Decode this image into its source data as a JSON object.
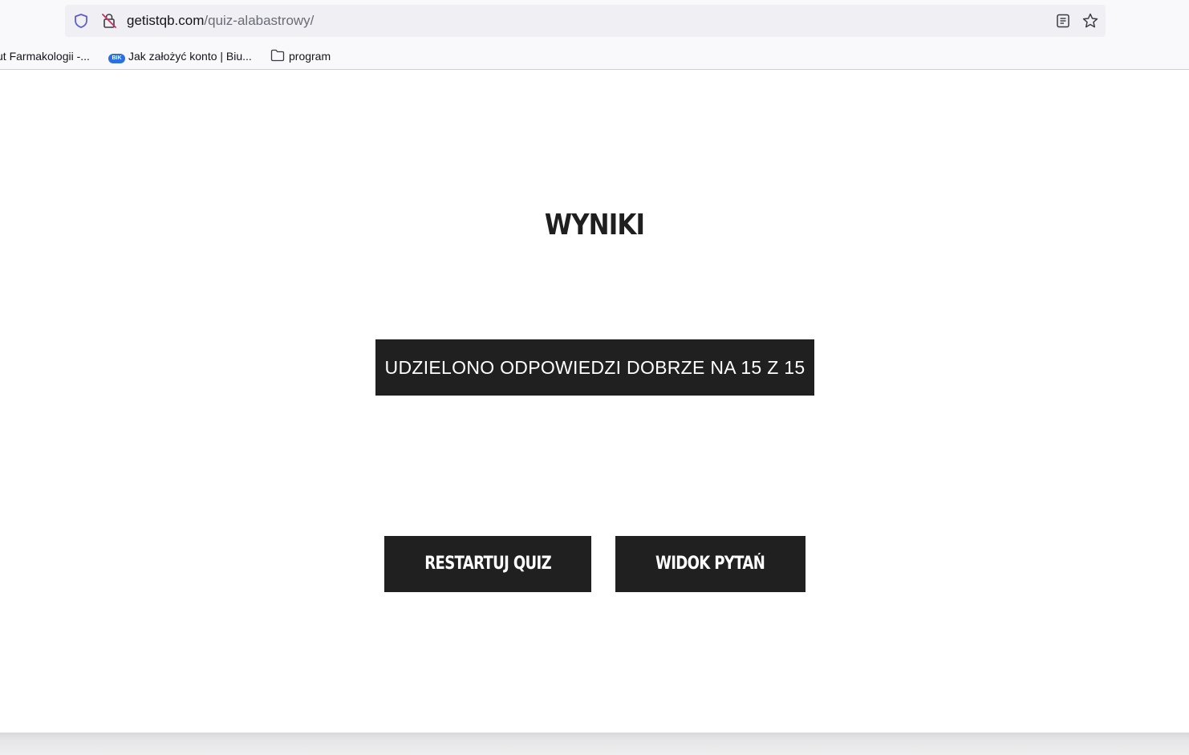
{
  "browser": {
    "url_domain": "getistqb.com",
    "url_path": "/quiz-alabastrowy/",
    "bookmarks": [
      {
        "label": "ut Farmakologii -...",
        "icon": "none"
      },
      {
        "label": "Jak założyć konto | Biu...",
        "icon": "bik-icon",
        "icon_text": "BIK"
      },
      {
        "label": "program",
        "icon": "folder-icon"
      }
    ]
  },
  "page": {
    "title": "WYNIKI",
    "score_text": "UDZIELONO ODPOWIEDZI DOBRZE NA 15 Z 15",
    "buttons": {
      "restart_label": "RESTARTUJ QUIZ",
      "view_label": "WIDOK PYTAŃ"
    }
  },
  "colors": {
    "button_bg": "#202020",
    "button_text": "#ffffff",
    "title": "#1f1f1f",
    "shield": "#5b5bd6",
    "lock_slash": "#e0245e"
  }
}
